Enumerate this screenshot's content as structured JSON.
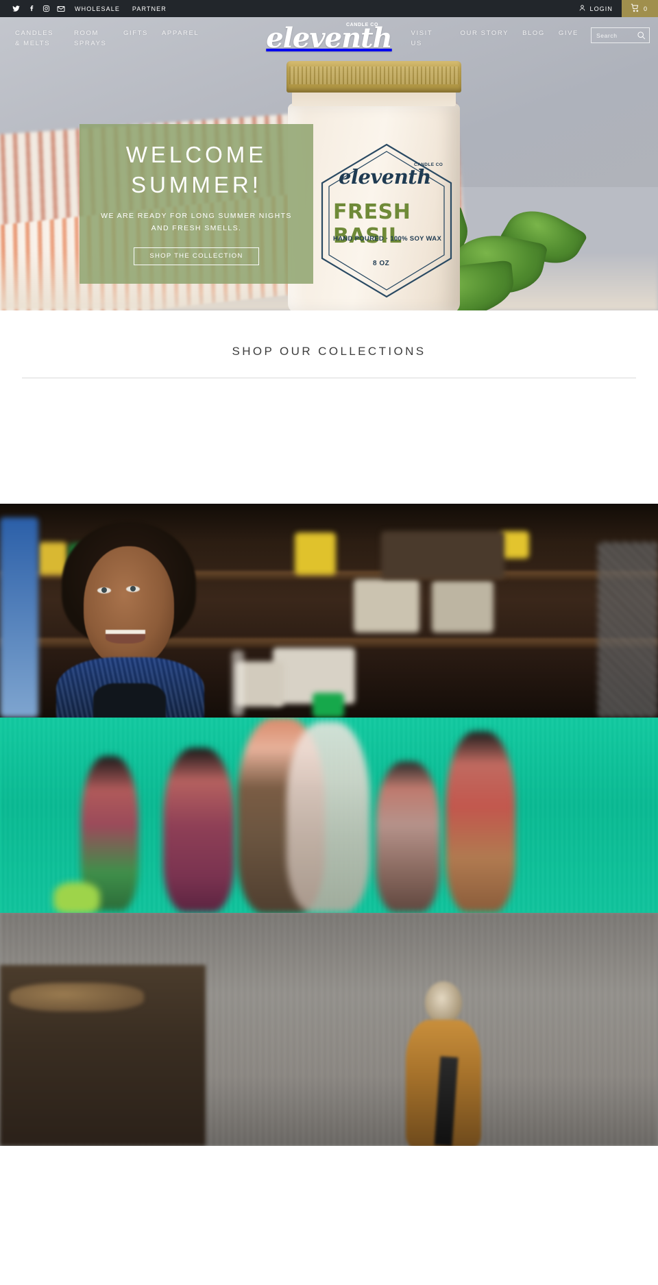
{
  "topbar": {
    "social": [
      {
        "name": "twitter-icon",
        "label": "Twitter"
      },
      {
        "name": "facebook-icon",
        "label": "Facebook"
      },
      {
        "name": "instagram-icon",
        "label": "Instagram"
      },
      {
        "name": "email-icon",
        "label": "Email"
      }
    ],
    "links": [
      {
        "label": "WHOLESALE"
      },
      {
        "label": "PARTNER"
      }
    ],
    "login_label": "LOGIN",
    "cart_count": "0",
    "cart_color": "#a08f4d",
    "bg_color": "#22262b"
  },
  "header": {
    "nav_left": [
      {
        "label": "CANDLES & MELTS"
      },
      {
        "label": "ROOM SPRAYS"
      },
      {
        "label": "GIFTS"
      },
      {
        "label": "APPAREL"
      }
    ],
    "nav_right": [
      {
        "label": "VISIT US"
      },
      {
        "label": "OUR STORY"
      },
      {
        "label": "BLOG"
      },
      {
        "label": "GIVE"
      }
    ],
    "logo": {
      "script": "eleventh",
      "tagline": "CANDLE CO"
    },
    "search": {
      "placeholder": "Search",
      "value": "",
      "icon": "search-icon"
    }
  },
  "hero": {
    "title": "WELCOME SUMMER!",
    "subtitle": "WE ARE READY FOR LONG SUMMER NIGHTS AND FRESH SMELLS.",
    "cta_label": "SHOP THE COLLECTION",
    "overlay_color": "#8da26c",
    "product": {
      "brand": "eleventh",
      "brand_sub": "CANDLE CO",
      "scent": "FRESH BASIL",
      "description": "HAND POURED · 100% SOY WAX",
      "size": "8 OZ"
    }
  },
  "collections": {
    "title": "SHOP OUR COLLECTIONS",
    "items": []
  },
  "strips": [
    {
      "name": "shopkeeper-photo",
      "alt": "Woman smiling in her shop"
    },
    {
      "name": "group-photo",
      "alt": "Group of people in front of a teal wall"
    },
    {
      "name": "market-photo",
      "alt": "Person at a market stall"
    }
  ]
}
